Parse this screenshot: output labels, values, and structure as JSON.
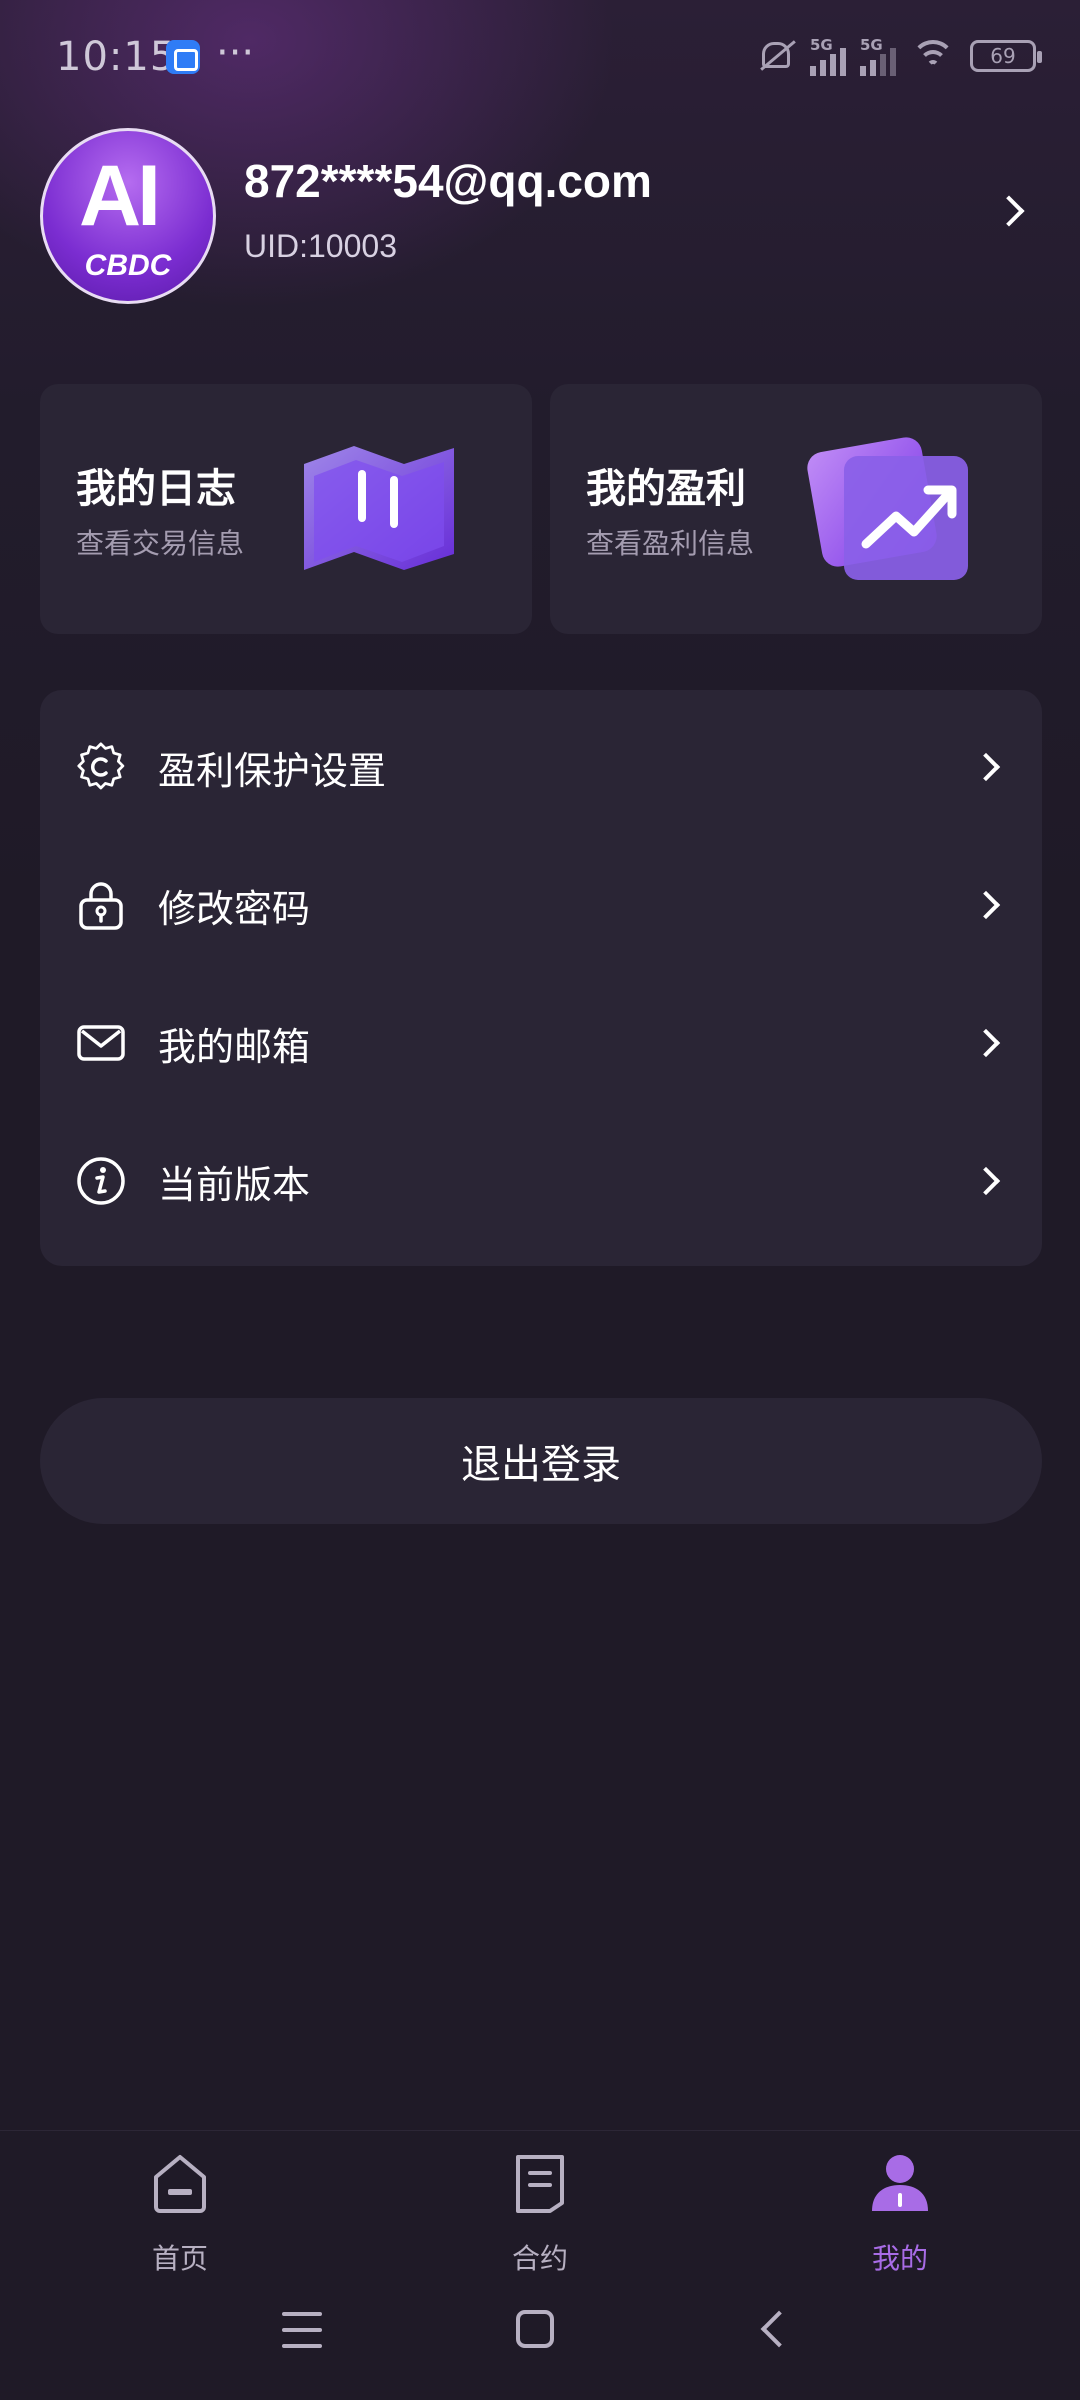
{
  "status_bar": {
    "time": "10:15",
    "more": "···",
    "network_1": "5G",
    "network_2": "5G",
    "battery": "69"
  },
  "profile": {
    "email": "872****54@qq.com",
    "uid": "UID:10003",
    "avatar_logo_top": "AI",
    "avatar_logo_bottom": "CBDC"
  },
  "cards": [
    {
      "title": "我的日志",
      "subtitle": "查看交易信息",
      "icon": "map-icon"
    },
    {
      "title": "我的盈利",
      "subtitle": "查看盈利信息",
      "icon": "trend-up-icon"
    }
  ],
  "menu": [
    {
      "label": "盈利保护设置",
      "icon": "gear-icon"
    },
    {
      "label": "修改密码",
      "icon": "lock-icon"
    },
    {
      "label": "我的邮箱",
      "icon": "mail-icon"
    },
    {
      "label": "当前版本",
      "icon": "info-icon"
    }
  ],
  "logout_label": "退出登录",
  "bottom_nav": [
    {
      "label": "首页",
      "icon": "home-icon",
      "active": false
    },
    {
      "label": "合约",
      "icon": "contract-icon",
      "active": false
    },
    {
      "label": "我的",
      "icon": "user-icon",
      "active": true
    }
  ],
  "colors": {
    "background": "#1f1a27",
    "card": "#2a2535",
    "accent": "#a86ce6"
  }
}
